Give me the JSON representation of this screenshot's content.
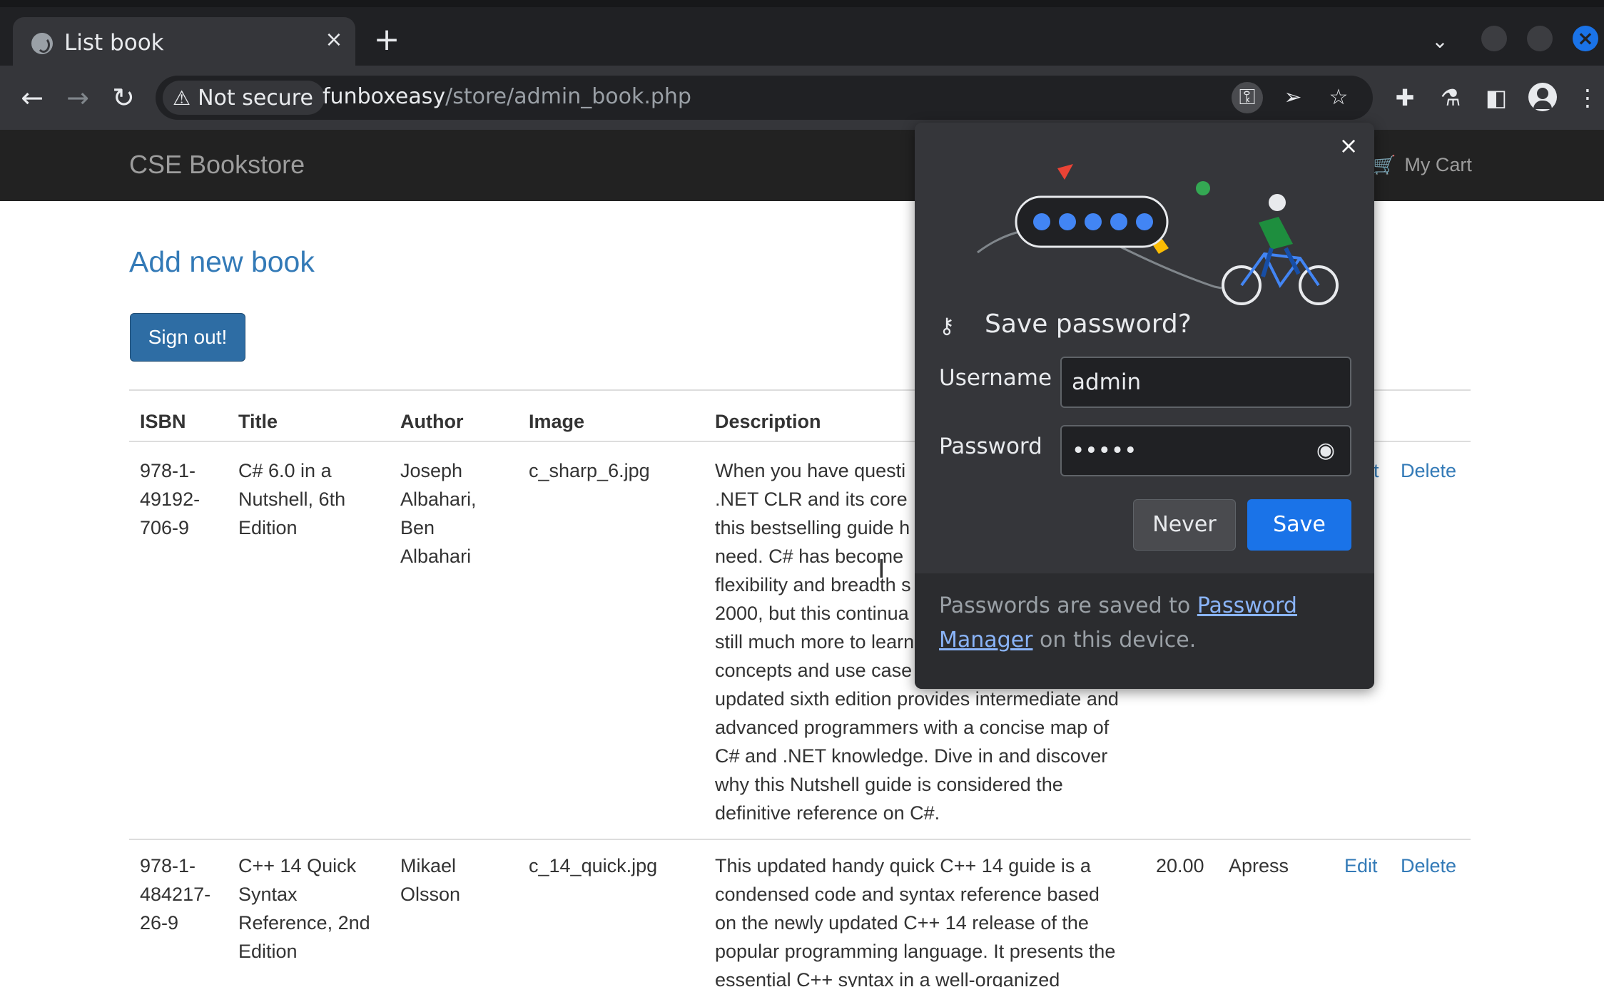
{
  "browser": {
    "tab_title": "List book",
    "tab_close": "×",
    "new_tab": "+",
    "security_chip": "Not secure",
    "url_host": "funboxeasy",
    "url_path": "/store/admin_book.php"
  },
  "site": {
    "brand": "CSE Bookstore",
    "cart_label": "My Cart",
    "add_new_book": "Add new book",
    "sign_out": "Sign out!"
  },
  "table": {
    "headers": [
      "ISBN",
      "Title",
      "Author",
      "Image",
      "Description"
    ],
    "rows": [
      {
        "isbn": [
          "978-1-",
          "49192-",
          "706-9"
        ],
        "title": [
          "C# 6.0 in a",
          "Nutshell, 6th",
          "Edition"
        ],
        "author": [
          "Joseph",
          "Albahari,",
          "Ben",
          "Albahari"
        ],
        "image": "c_sharp_6.jpg",
        "description": [
          "When you have questi",
          ".NET CLR and its core",
          "this bestselling guide h",
          "need. C# has become",
          "flexibility and breadth s",
          "2000, but this continua",
          "still much more to learn",
          "concepts and use case",
          "updated sixth edition provides intermediate and",
          "advanced programmers with a concise map of",
          "C# and .NET knowledge. Dive in and discover",
          "why this Nutshell guide is considered the",
          "definitive reference on C#."
        ],
        "edit_partial": "t",
        "delete": "Delete"
      },
      {
        "isbn": [
          "978-1-",
          "484217-",
          "26-9"
        ],
        "title": [
          "C++ 14 Quick",
          "Syntax",
          "Reference, 2nd",
          "Edition"
        ],
        "author": [
          "Mikael",
          "Olsson"
        ],
        "image": "c_14_quick.jpg",
        "description": [
          "This updated handy quick C++ 14 guide is a",
          "condensed code and syntax reference based",
          "on the newly updated C++ 14 release of the",
          "popular programming language. It presents the",
          "essential C++ syntax in a well-organized"
        ],
        "price": "20.00",
        "publisher": "Apress",
        "edit": "Edit",
        "delete": "Delete"
      }
    ]
  },
  "password_bubble": {
    "close": "×",
    "title": "Save password?",
    "username_label": "Username",
    "username_value": "admin",
    "password_label": "Password",
    "password_value": "•••••",
    "never": "Never",
    "save": "Save",
    "footer_prefix": "Passwords are saved to ",
    "footer_link_1": "Password",
    "footer_link_2": "Manager",
    "footer_suffix": " on this device."
  },
  "colors": {
    "accent_blue": "#1a73e8",
    "link_blue": "#337ab7",
    "signout_blue": "#2e6da4",
    "navbar": "#222222"
  },
  "icons": [
    "globe-icon",
    "warning-icon",
    "key-icon",
    "send-icon",
    "star-icon",
    "puzzle-icon",
    "flask-icon",
    "sidepanel-icon",
    "avatar",
    "more-icon",
    "cart-icon",
    "eye-icon"
  ]
}
